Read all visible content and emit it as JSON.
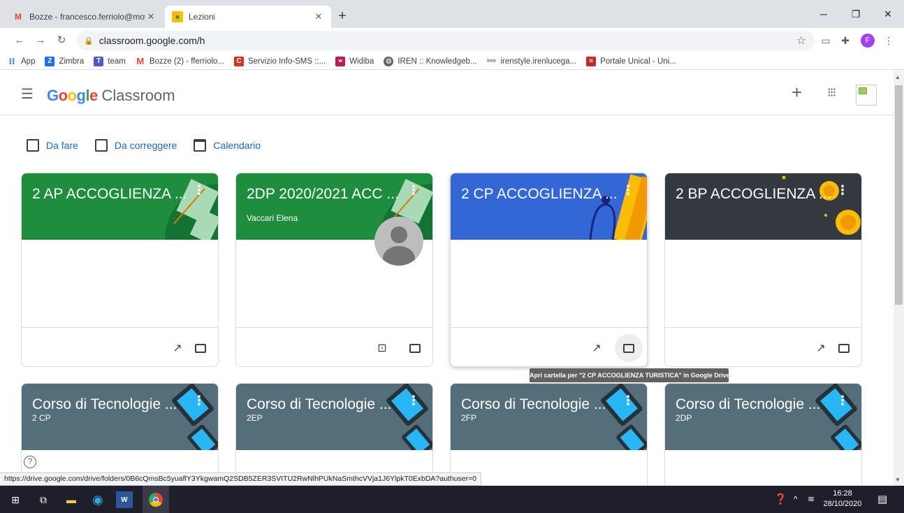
{
  "browser": {
    "tabs": [
      {
        "title": "Bozze - francesco.ferriolo@mott",
        "favicon": "gmail-icon"
      },
      {
        "title": "Lezioni",
        "favicon": "classroom-icon"
      }
    ],
    "new_tab": "+",
    "url": "classroom.google.com/h",
    "profile_initial": "F",
    "bookmarks": [
      {
        "label": "App",
        "color": "#1a73e8"
      },
      {
        "label": "Zimbra",
        "color": "#1a73e8",
        "glyph": "Z"
      },
      {
        "label": "team",
        "color": "#5059c9"
      },
      {
        "label": "Bozze (2) - fferriolo...",
        "color": "#ea4335",
        "glyph": "M"
      },
      {
        "label": "Servizio Info-SMS ::...",
        "color": "#d93025",
        "glyph": "C"
      },
      {
        "label": "Widiba",
        "color": "#c2185b"
      },
      {
        "label": "IREN :: Knowledgeb...",
        "color": "#5f6368"
      },
      {
        "label": "irenstyle.irenlucega...",
        "color": "#5f6368"
      },
      {
        "label": "Portale Unical - Uni...",
        "color": "#c62828"
      }
    ]
  },
  "classroom": {
    "brand_google": "Google",
    "brand_product": "Classroom",
    "nav": [
      {
        "label": "Da fare"
      },
      {
        "label": "Da correggere"
      },
      {
        "label": "Calendario"
      }
    ],
    "cards_top": [
      {
        "title": "2 AP ACCOGLIENZA ...",
        "subtitle": "",
        "color": "#1e8e3e"
      },
      {
        "title": "2DP 2020/2021 ACC ...",
        "subtitle": "Vaccari Elena",
        "color": "#1e8e3e"
      },
      {
        "title": "2 CP ACCOGLIENZA ...",
        "subtitle": "",
        "color": "#3367d6"
      },
      {
        "title": "2 BP ACCOGLIENZA ...",
        "subtitle": "",
        "color": "#34393f"
      }
    ],
    "cards_bottom": [
      {
        "title": "Corso di Tecnologie ...",
        "subtitle": "2 CP",
        "color": "#546e7a"
      },
      {
        "title": "Corso di Tecnologie ...",
        "subtitle": "2EP",
        "color": "#546e7a"
      },
      {
        "title": "Corso di Tecnologie ...",
        "subtitle": "2FP",
        "color": "#546e7a"
      },
      {
        "title": "Corso di Tecnologie ...",
        "subtitle": "2DP",
        "color": "#546e7a"
      }
    ],
    "tooltip": "Apri cartella per \"2 CP ACCOGLIENZA TURISTICA\" in Google Drive",
    "help": "?"
  },
  "status_url": "https://drive.google.com/drive/folders/0B6cQmsBc5yuaflY3YkgwamQ2SDB5ZER3SVITU2RwNlhPUkNaSmthcVVja1J6YlpkT0ExbDA?authuser=0",
  "taskbar": {
    "time": "16:28",
    "date": "28/10/2020"
  }
}
